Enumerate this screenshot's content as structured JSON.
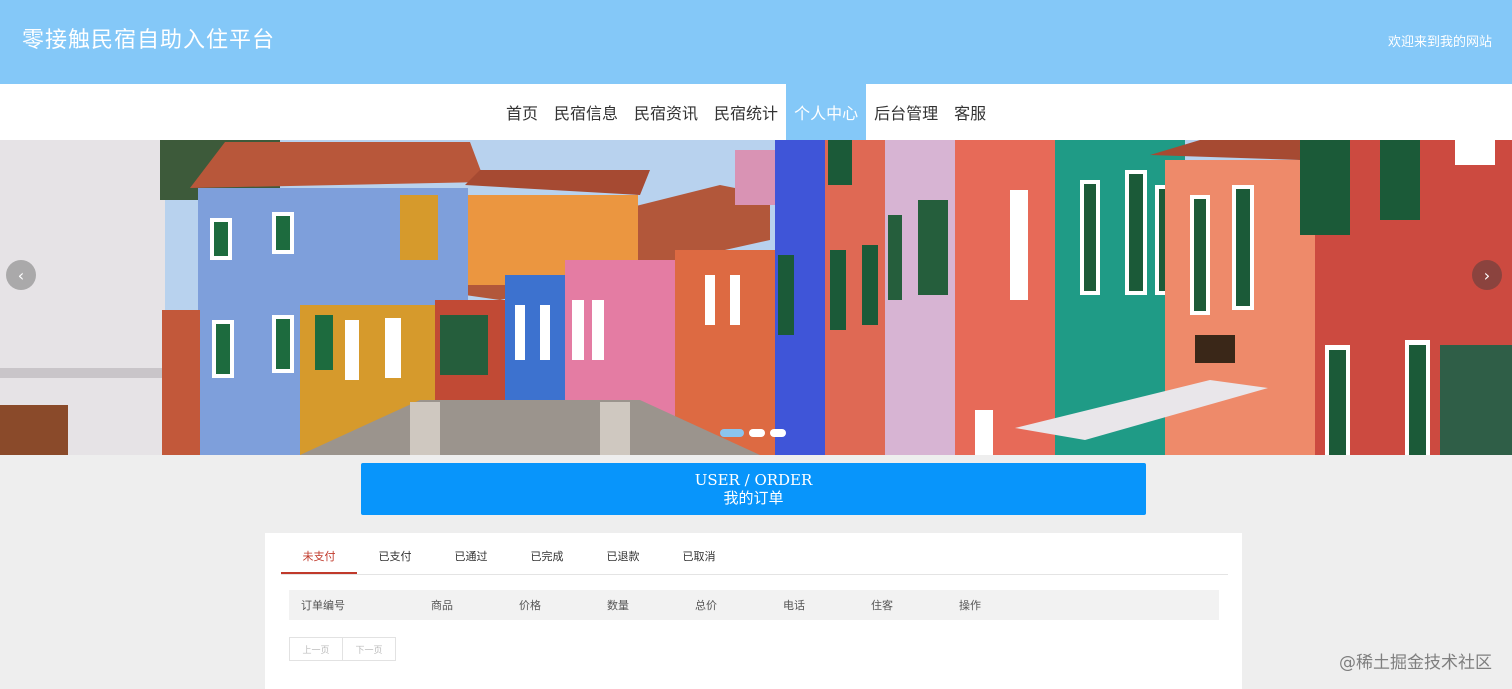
{
  "header": {
    "site_title": "零接触民宿自助入住平台",
    "welcome": "欢迎来到我的网站",
    "bg_color": "#84c8f8"
  },
  "nav": {
    "items": [
      {
        "label": "首页"
      },
      {
        "label": "民宿信息"
      },
      {
        "label": "民宿资讯"
      },
      {
        "label": "民宿统计"
      },
      {
        "label": "个人中心",
        "active": true
      },
      {
        "label": "后台管理"
      },
      {
        "label": "客服"
      }
    ]
  },
  "banner": {
    "prev_icon": "‹",
    "next_icon": "›",
    "slide_count": 3,
    "active_slide": 1
  },
  "order_head": {
    "title_en": "USER / ORDER",
    "title_cn": "我的订单",
    "color": "#0895fb"
  },
  "orders": {
    "tabs": [
      "未支付",
      "已支付",
      "已通过",
      "已完成",
      "已退款",
      "已取消"
    ],
    "active_tab": 0,
    "columns": [
      "订单编号",
      "商品",
      "价格",
      "数量",
      "总价",
      "电话",
      "住客",
      "操作"
    ],
    "pager": {
      "prev": "上一页",
      "next": "下一页"
    }
  },
  "watermark": "@稀土掘金技术社区"
}
